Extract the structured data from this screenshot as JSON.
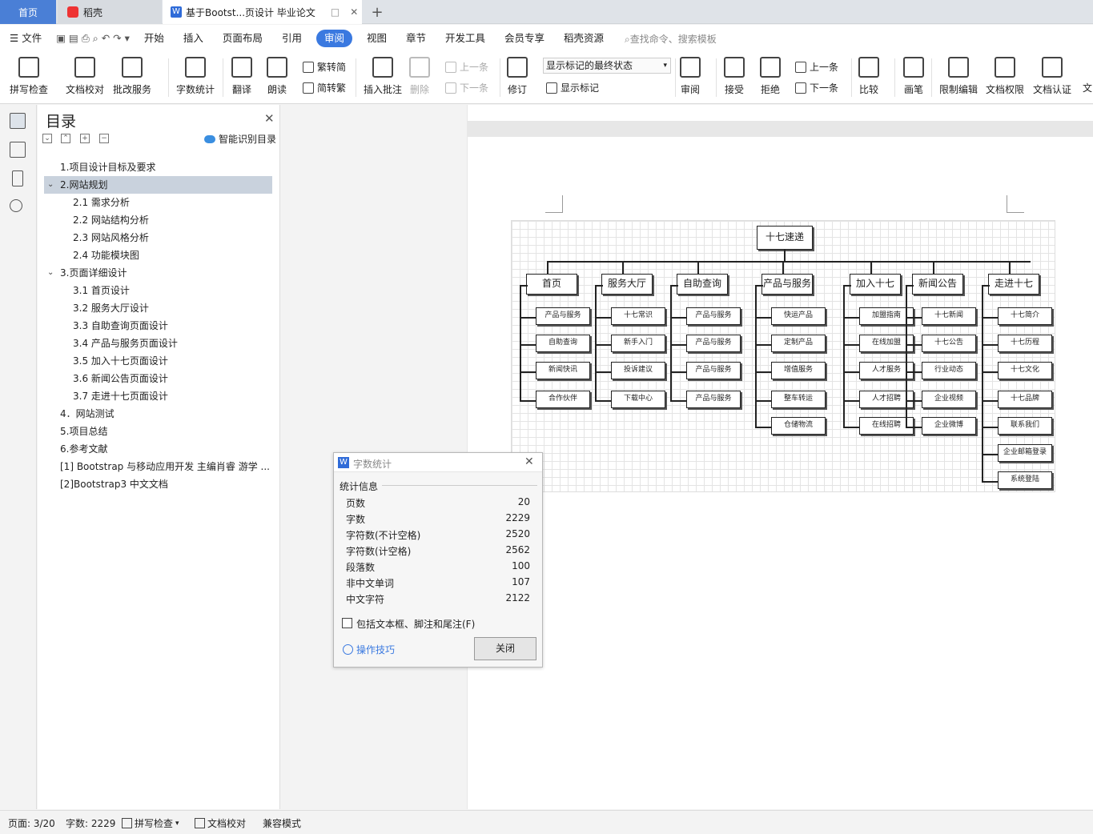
{
  "tabs": {
    "home": "首页",
    "daoke": "稻壳",
    "doc": "基于Bootst...页设计 毕业论文",
    "add": "+"
  },
  "menu": {
    "file": "文件",
    "items": [
      "开始",
      "插入",
      "页面布局",
      "引用",
      "审阅",
      "视图",
      "章节",
      "开发工具",
      "会员专享",
      "稻壳资源"
    ],
    "active": "审阅",
    "search": "查找命令、搜索模板"
  },
  "ribbon": {
    "spell": "拼写检查",
    "proof": "文档校对",
    "revise_service": "批改服务",
    "word_count": "字数统计",
    "translate": "翻译",
    "read": "朗读",
    "to_trad": "繁转简",
    "to_simp": "简转繁",
    "insert_comment": "插入批注",
    "delete": "删除",
    "prev": "上一条",
    "next": "下一条",
    "track": "修订",
    "markup_state": "显示标记的最终状态",
    "show_markup": "显示标记",
    "review": "审阅",
    "accept": "接受",
    "reject": "拒绝",
    "prev2": "上一条",
    "next2": "下一条",
    "compare": "比较",
    "pen": "画笔",
    "restrict": "限制编辑",
    "permission": "文档权限",
    "certify": "文档认证",
    "more": "文"
  },
  "toc": {
    "title": "目录",
    "smart": "智能识别目录",
    "items": [
      "1.项目设计目标及要求",
      "2.网站规划",
      "2.1 需求分析",
      "2.2 网站结构分析",
      "2.3 网站风格分析",
      "2.4 功能模块图",
      "3.页面详细设计",
      "3.1 首页设计",
      "3.2 服务大厅设计",
      "3.3 自助查询页面设计",
      "3.4 产品与服务页面设计",
      "3.5 加入十七页面设计",
      "3.6 新闻公告页面设计",
      "3.7 走进十七页面设计",
      "4．网站测试",
      "5.项目总结",
      "6.参考文献",
      "[1] Bootstrap 与移动应用开发 主编肖睿 游学 ...",
      "[2]Bootstrap3 中文文档"
    ]
  },
  "diagram": {
    "root": "十七速递",
    "columns": [
      {
        "head": "首页",
        "children": [
          "产品与服务",
          "自助查询",
          "新闻快讯",
          "合作伙伴"
        ]
      },
      {
        "head": "服务大厅",
        "children": [
          "十七常识",
          "新手入门",
          "投诉建议",
          "下载中心"
        ]
      },
      {
        "head": "自助查询",
        "children": [
          "产品与服务",
          "产品与服务",
          "产品与服务",
          "产品与服务"
        ]
      },
      {
        "head": "产品与服务",
        "children": [
          "快运产品",
          "定制产品",
          "增值服务",
          "整车转运",
          "仓储物流"
        ]
      },
      {
        "head": "加入十七",
        "children": [
          "加盟指南",
          "在线加盟",
          "人才服务",
          "人才招聘",
          "在线招聘"
        ]
      },
      {
        "head": "新闻公告",
        "children": [
          "十七新闻",
          "十七公告",
          "行业动态",
          "企业视频",
          "企业微博"
        ]
      },
      {
        "head": "走进十七",
        "children": [
          "十七简介",
          "十七历程",
          "十七文化",
          "十七品牌",
          "联系我们",
          "企业邮箱登录",
          "系统登陆"
        ]
      }
    ]
  },
  "dialog": {
    "title": "字数统计",
    "section": "统计信息",
    "rows": [
      {
        "label": "页数",
        "value": "20"
      },
      {
        "label": "字数",
        "value": "2229"
      },
      {
        "label": "字符数(不计空格)",
        "value": "2520"
      },
      {
        "label": "字符数(计空格)",
        "value": "2562"
      },
      {
        "label": "段落数",
        "value": "100"
      },
      {
        "label": "非中文单词",
        "value": "107"
      },
      {
        "label": "中文字符",
        "value": "2122"
      }
    ],
    "checkbox": "包括文本框、脚注和尾注(F)",
    "tips": "操作技巧",
    "close": "关闭"
  },
  "status": {
    "page": "页面: 3/20",
    "words": "字数: 2229",
    "spell": "拼写检查",
    "proof": "文档校对",
    "compat": "兼容模式"
  },
  "colors": {
    "accent": "#3a79e0",
    "tab_home": "#4a7fd6"
  }
}
